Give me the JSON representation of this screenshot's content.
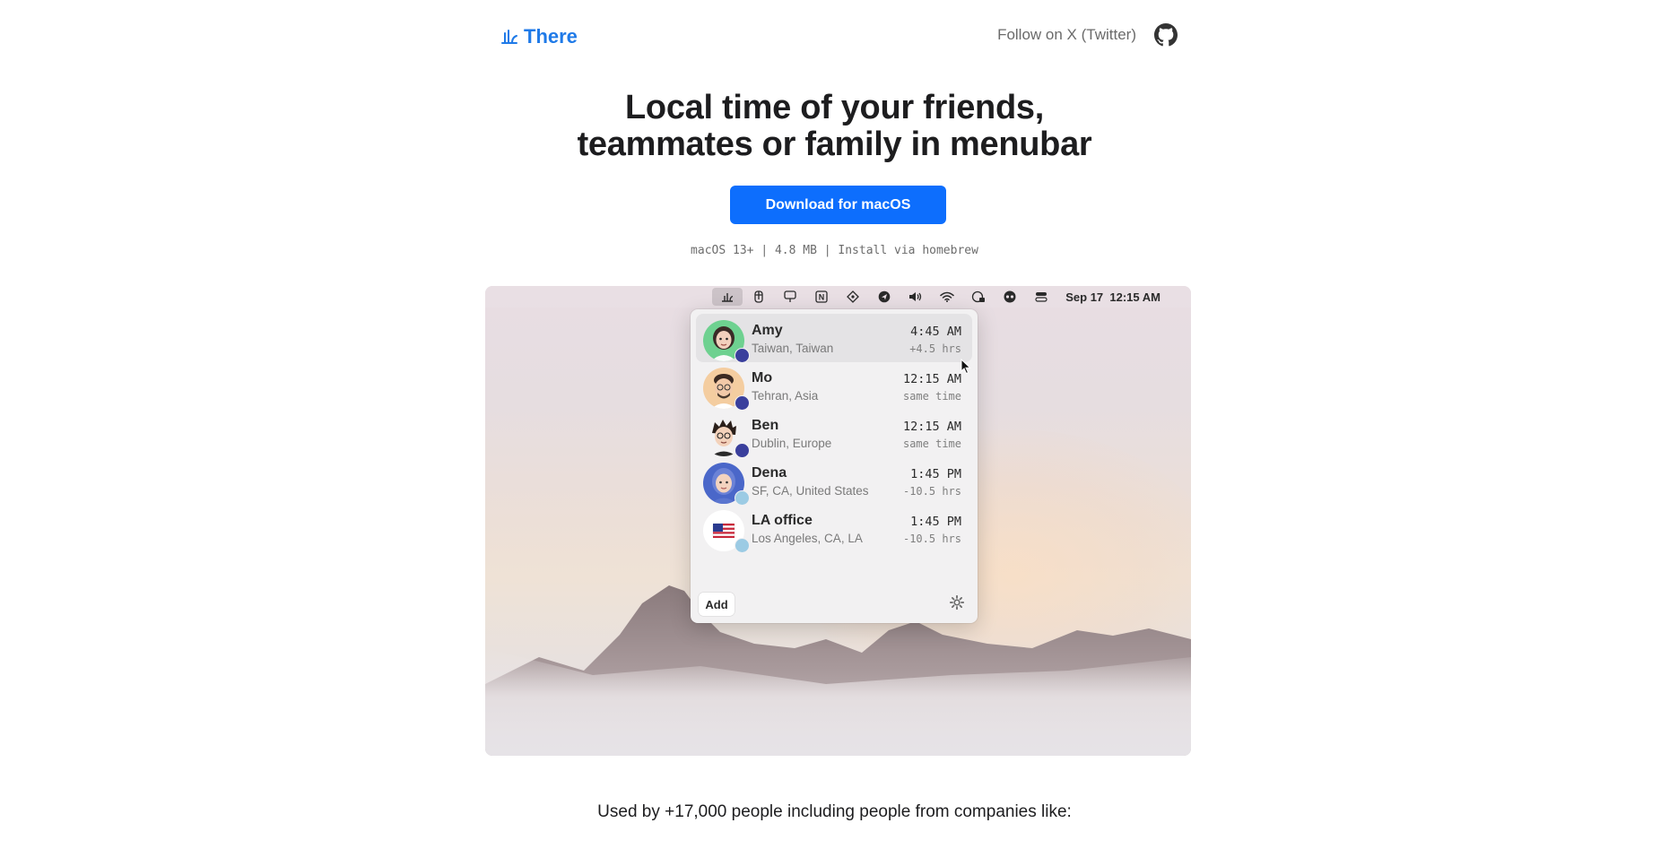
{
  "header": {
    "logo_text": "There",
    "follow_link": "Follow on X (Twitter)",
    "github_icon": "github-icon"
  },
  "hero": {
    "title_line1": "Local time of your friends,",
    "title_line2": "teammates or family in menubar",
    "download_label": "Download for macOS",
    "meta": "macOS 13+ | 4.8 MB | Install via homebrew"
  },
  "screenshot": {
    "menubar": {
      "date": "Sep 17",
      "time": "12:15 AM",
      "icons": [
        "there-app-icon",
        "figma-icon",
        "presentation-icon",
        "notion-icon",
        "diamond-icon",
        "send-icon",
        "volume-icon",
        "wifi-icon",
        "lock-clock-icon",
        "eyes-icon",
        "control-center-icon"
      ]
    },
    "popup": {
      "people": [
        {
          "name": "Amy",
          "location": "Taiwan, Taiwan",
          "time": "4:45 AM",
          "diff": "+4.5 hrs",
          "badge": "moon"
        },
        {
          "name": "Mo",
          "location": "Tehran, Asia",
          "time": "12:15 AM",
          "diff": "same time",
          "badge": "moon"
        },
        {
          "name": "Ben",
          "location": "Dublin, Europe",
          "time": "12:15 AM",
          "diff": "same time",
          "badge": "moon"
        },
        {
          "name": "Dena",
          "location": "SF, CA, United States",
          "time": "1:45 PM",
          "diff": "-10.5 hrs",
          "badge": "sun"
        },
        {
          "name": "LA office",
          "location": "Los Angeles, CA, LA",
          "time": "1:45 PM",
          "diff": "-10.5 hrs",
          "badge": "sun"
        }
      ],
      "add_label": "Add",
      "settings_icon": "gear-icon"
    }
  },
  "footer": {
    "used_by": "Used by +17,000 people including people from companies like:"
  },
  "colors": {
    "brand": "#1f7ae8",
    "button": "#0d6efd"
  }
}
